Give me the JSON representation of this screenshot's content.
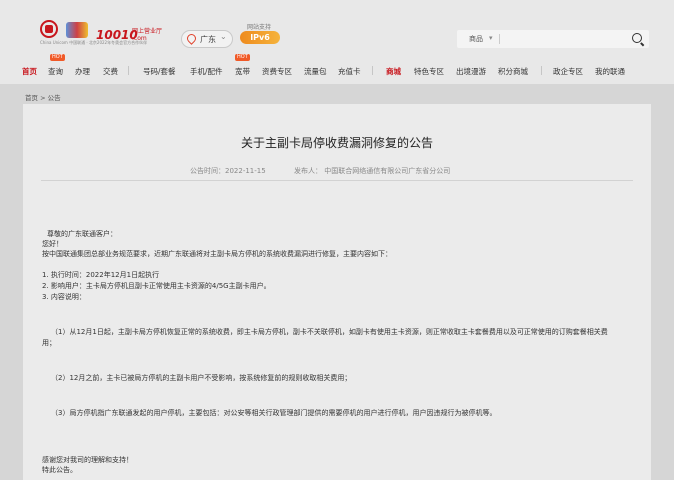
{
  "header": {
    "logo_text": "China Unicom 中国联通 · 北京2022年冬奥会官方合作伙伴",
    "brand": "10010",
    "brand_sub_1": "网上营业厅",
    "brand_sub_2": ".com",
    "region": "广东",
    "ipv6_caption": "网站支持",
    "ipv6_label": "IPv6",
    "search_select": "商品",
    "hot_badge": "HOT"
  },
  "nav": {
    "items": [
      "首页",
      "查询",
      "办理",
      "交费",
      "号码/套餐",
      "手机/配件",
      "宽带",
      "资费专区",
      "流量包",
      "充值卡",
      "商城",
      "特色专区",
      "出境漫游",
      "积分商城",
      "政企专区",
      "我的联通"
    ]
  },
  "breadcrumb": "首页 > 公告",
  "article": {
    "title": "关于主副卡局停收费漏洞修复的公告",
    "time_label": "公告时间：2022-11-15",
    "publisher_label": "发布人：  中国联合网络通信有限公司广东省分公司",
    "lines": [
      "尊敬的广东联通客户：",
      "您好！",
      "按中国联通集团总部业务规范要求，近期广东联通将对主副卡局方停机的系统收费漏洞进行修复，主要内容如下：",
      "1. 执行时间：2022年12月1日起执行",
      "2. 影响用户：主卡局方停机且副卡正常使用主卡资源的4/5G主副卡用户。",
      "3. 内容说明：",
      "（1）从12月1日起，主副卡局方停机恢复正常的系统收费，即主卡局方停机，副卡不关联停机，如副卡有使用主卡资源，则正常收取主卡套餐费用以及可正常使用的订购套餐相关费",
      "用；",
      "（2）12月之前，主卡已被局方停机的主副卡用户不受影响，按系统修复前的规则收取相关费用；",
      "（3）局方停机指广东联通发起的用户停机，主要包括：对公安等相关行政管理部门提供的需要停机的用户进行停机，用户因违规行为被停机等。",
      "感谢您对我司的理解和支持！",
      "特此公告。"
    ]
  }
}
